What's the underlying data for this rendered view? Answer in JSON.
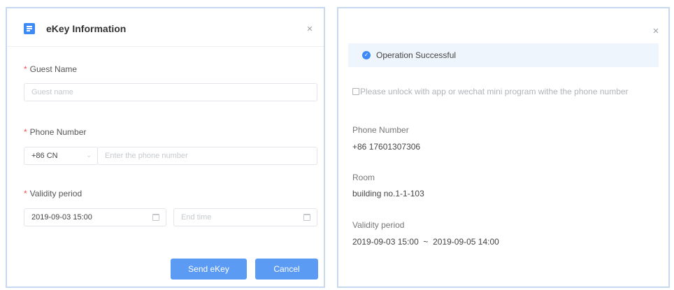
{
  "left_dialog": {
    "title": "eKey Information",
    "close_symbol": "×",
    "app_icon": "document-icon",
    "required_mark": "*",
    "guest_name": {
      "label": "Guest Name",
      "placeholder": "Guest name"
    },
    "phone_number": {
      "label": "Phone Number",
      "country_code": "+86 CN",
      "placeholder": "Enter the phone number"
    },
    "validity_period": {
      "label": "Validity period",
      "start_value": "2019-09-03 15:00",
      "end_placeholder": "End time"
    },
    "send_button": "Send eKey",
    "cancel_button": "Cancel"
  },
  "right_dialog": {
    "close_symbol": "×",
    "status": "Operation Successful",
    "note": "Please unlock with app or wechat mini program withe the phone number",
    "phone_label": "Phone Number",
    "phone_value": "+86 17601307306",
    "room_label": "Room",
    "room_value": "building no.1-1-103",
    "validity_label": "Validity period",
    "validity_value": "2019-09-03 15:00  ~  2019-09-05 14:00"
  },
  "colors": {
    "accent": "#3d8af7",
    "button": "#5b9bf3",
    "required": "#ef4f4f",
    "panel_border": "#c6d9ef",
    "success_bg": "#eff5fc"
  }
}
